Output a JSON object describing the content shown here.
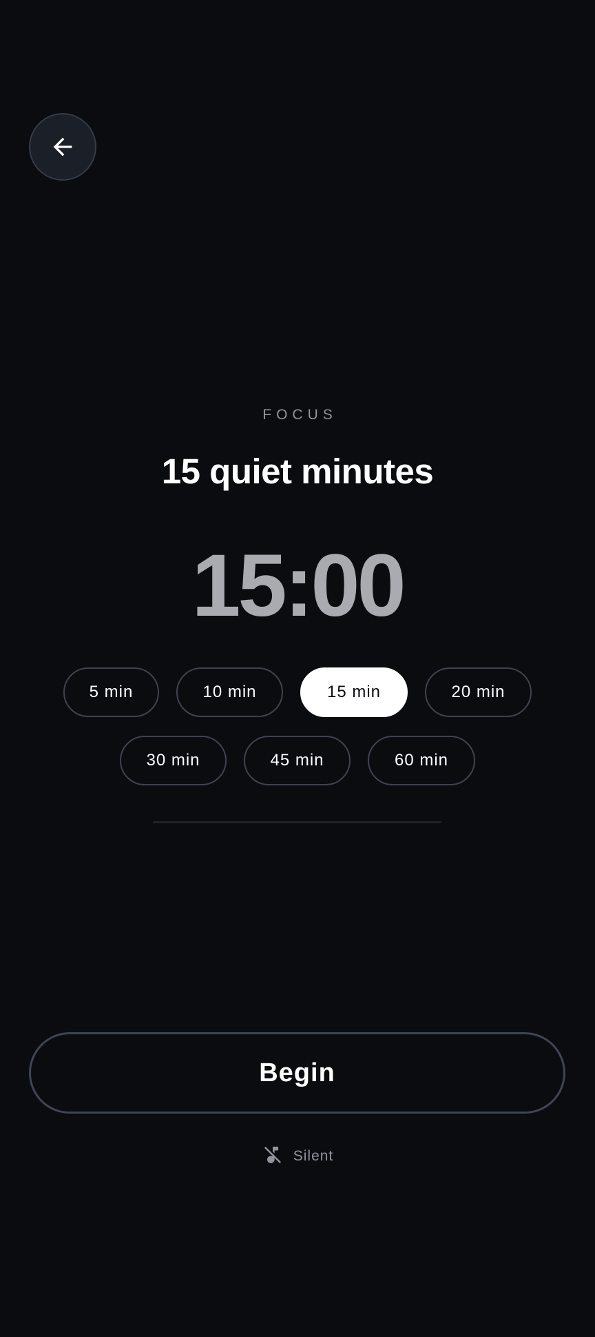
{
  "header": {
    "back_icon": "arrow-left-icon"
  },
  "session": {
    "category": "FOCUS",
    "title": "15 quiet minutes",
    "timer": "15:00"
  },
  "durations": [
    {
      "label": "5 min",
      "selected": false
    },
    {
      "label": "10 min",
      "selected": false
    },
    {
      "label": "15 min",
      "selected": true
    },
    {
      "label": "20 min",
      "selected": false
    },
    {
      "label": "30 min",
      "selected": false
    },
    {
      "label": "45 min",
      "selected": false
    },
    {
      "label": "60 min",
      "selected": false
    }
  ],
  "actions": {
    "begin_label": "Begin"
  },
  "sound": {
    "icon": "music-off-icon",
    "label": "Silent"
  },
  "colors": {
    "background": "#0b0c10",
    "accent": "#ffffff",
    "muted_text": "#8f949d",
    "timer_text": "#a9abb0",
    "outline": "#3e4350"
  }
}
